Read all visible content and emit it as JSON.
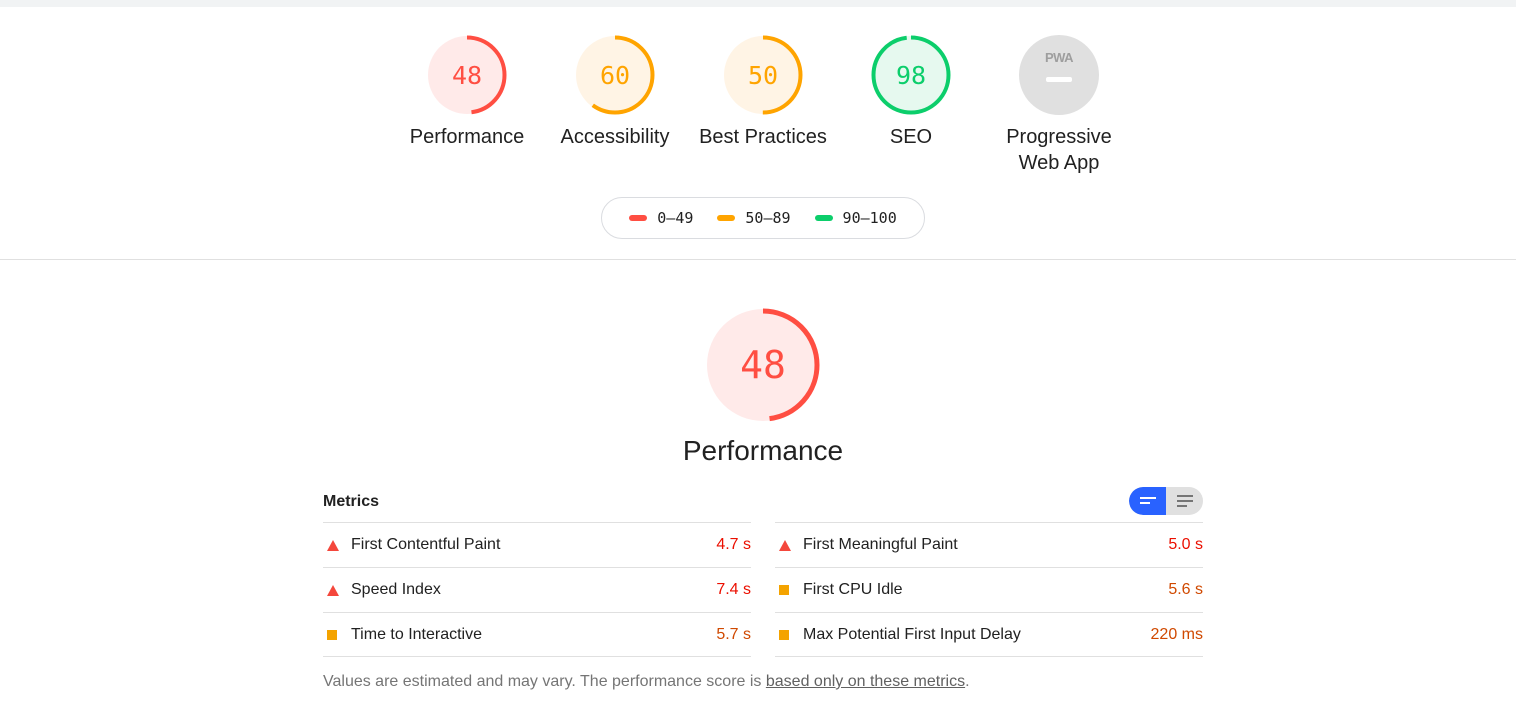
{
  "colors": {
    "fail": "#ff4e42",
    "fail_text": "#eb0f00",
    "average": "#ffa400",
    "average_text": "#d04900",
    "pass": "#0cce6b",
    "pass_text": "#018642",
    "na": "#9e9e9e"
  },
  "categories": [
    {
      "score": "48",
      "score_value": 48,
      "label": "Performance",
      "rating": "fail"
    },
    {
      "score": "60",
      "score_value": 60,
      "label": "Accessibility",
      "rating": "average"
    },
    {
      "score": "50",
      "score_value": 50,
      "label": "Best Practices",
      "rating": "average"
    },
    {
      "score": "98",
      "score_value": 98,
      "label": "SEO",
      "rating": "pass"
    },
    {
      "score": "",
      "score_value": null,
      "label": "Progressive Web App",
      "label_line1": "Progressive",
      "label_line2": "Web App",
      "icon": "pwa-icon",
      "rating": "na"
    }
  ],
  "legend": [
    {
      "range": "0–49",
      "rating": "fail"
    },
    {
      "range": "50–89",
      "rating": "average"
    },
    {
      "range": "90–100",
      "rating": "pass"
    }
  ],
  "performance": {
    "score": "48",
    "score_value": 48,
    "title": "Performance",
    "metrics_title": "Metrics",
    "view_toggle": {
      "active": "opportunities-view",
      "options": [
        "opportunities-view-icon",
        "list-view-icon"
      ]
    },
    "metrics_left": [
      {
        "name": "First Contentful Paint",
        "value": "4.7 s",
        "rating": "fail"
      },
      {
        "name": "Speed Index",
        "value": "7.4 s",
        "rating": "fail"
      },
      {
        "name": "Time to Interactive",
        "value": "5.7 s",
        "rating": "average"
      }
    ],
    "metrics_right": [
      {
        "name": "First Meaningful Paint",
        "value": "5.0 s",
        "rating": "fail"
      },
      {
        "name": "First CPU Idle",
        "value": "5.6 s",
        "rating": "average"
      },
      {
        "name": "Max Potential First Input Delay",
        "value": "220 ms",
        "rating": "average"
      }
    ],
    "footnote_text": "Values are estimated and may vary. The performance score is ",
    "footnote_link": "based only on these metrics",
    "footnote_end": "."
  }
}
